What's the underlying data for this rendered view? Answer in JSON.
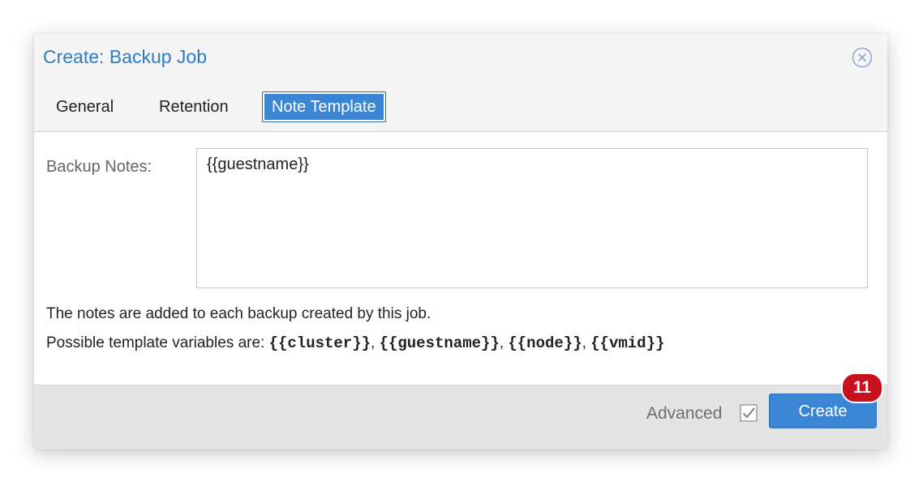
{
  "dialog": {
    "title": "Create: Backup Job",
    "close_icon": "close-circle-icon"
  },
  "tabs": [
    {
      "label": "General",
      "active": false
    },
    {
      "label": "Retention",
      "active": false
    },
    {
      "label": "Note Template",
      "active": true
    }
  ],
  "form": {
    "notes_label": "Backup Notes:",
    "notes_value": "{{guestname}}",
    "help_line1": "The notes are added to each backup created by this job.",
    "help_line2_prefix": "Possible template variables are: ",
    "variables": [
      "{{cluster}}",
      "{{guestname}}",
      "{{node}}",
      "{{vmid}}"
    ],
    "separator": ", "
  },
  "footer": {
    "advanced_label": "Advanced",
    "advanced_checked": true,
    "create_label": "Create"
  },
  "badge": {
    "value": "11"
  },
  "colors": {
    "accent": "#3a86d4",
    "title": "#2d7cc4",
    "badge": "#c8101e"
  }
}
